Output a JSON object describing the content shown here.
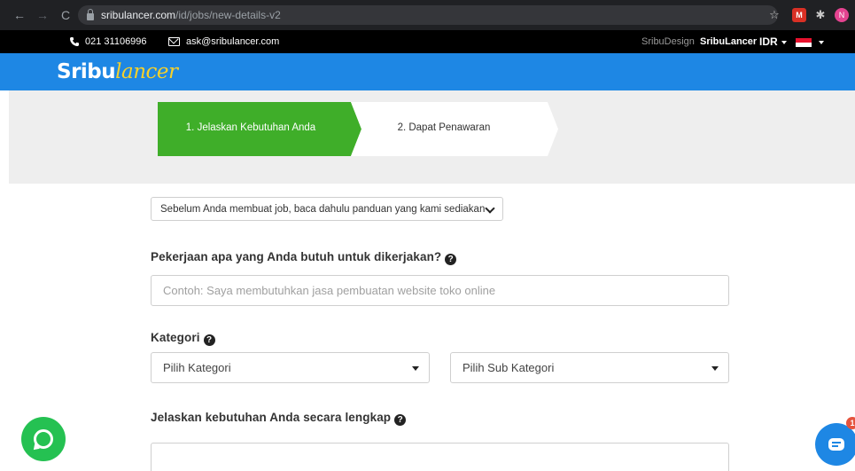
{
  "browser": {
    "url_host": "sribulancer.com",
    "url_path": "/id/jobs/new-details-v2",
    "avatar_initial": "N",
    "ext_label": "M"
  },
  "topbar": {
    "phone": "021 31106996",
    "email": "ask@sribulancer.com",
    "link1": "SribuDesign",
    "link2": "SribuLancer",
    "currency": "IDR"
  },
  "header": {
    "logo_main": "Sribu",
    "logo_accent": "lancer"
  },
  "steps": [
    {
      "label": "1. Jelaskan Kebutuhan Anda",
      "color": "#3fae29"
    },
    {
      "label": "2. Dapat Penawaran",
      "color": "#ffffff"
    }
  ],
  "form": {
    "guide_text": "Sebelum Anda membuat job, baca dahulu panduan yang kami sediakan",
    "job_label": "Pekerjaan apa yang Anda butuh untuk dikerjakan?",
    "job_placeholder": "Contoh: Saya membutuhkan jasa pembuatan website toko online",
    "category_label": "Kategori",
    "category_select": "Pilih Kategori",
    "subcategory_select": "Pilih Sub Kategori",
    "desc_label": "Jelaskan kebutuhan Anda secara lengkap"
  },
  "chat": {
    "badge_count": "1"
  },
  "colors": {
    "brand_blue": "#1e87e4",
    "step_green": "#3fae29",
    "whatsapp": "#25c152"
  }
}
